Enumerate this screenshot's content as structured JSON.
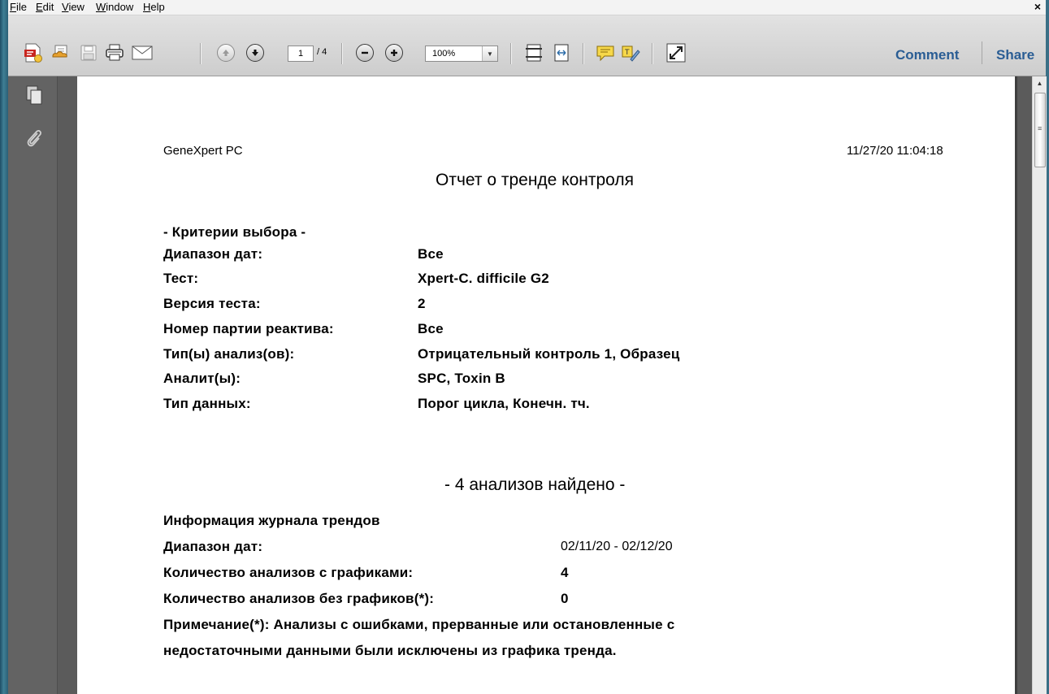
{
  "menu": [
    "File",
    "Edit",
    "View",
    "Window",
    "Help"
  ],
  "window": {
    "close_glyph": "×"
  },
  "toolbar": {
    "icons": [
      "create-pdf-icon",
      "save-to-cloud-icon",
      "save-icon",
      "print-icon",
      "email-icon",
      "previous-page-icon",
      "next-page-icon",
      "zoom-out-icon",
      "zoom-in-icon",
      "fit-page-icon",
      "fit-width-icon",
      "sticky-note-icon",
      "highlight-icon",
      "fullscreen-icon"
    ],
    "page_current": "1",
    "page_total": "/ 4",
    "zoom": "100%",
    "comment": "Comment",
    "share": "Share"
  },
  "colors": {
    "link_blue": "#2a5d94",
    "panel_grey": "#636363",
    "doc_bg": "#5b5b5b"
  },
  "document": {
    "header_left": "GeneXpert PC",
    "header_right": "11/27/20 11:04:18",
    "title": "Отчет о тренде контроля",
    "criteria_heading": "- Критерии выбора -",
    "criteria": [
      {
        "label": "Диапазон дат:",
        "value": "Все"
      },
      {
        "label": "Тест:",
        "value": "Xpert-C. difficile G2"
      },
      {
        "label": "Версия теста:",
        "value": "2"
      },
      {
        "label": "Номер партии реактива:",
        "value": "Все"
      },
      {
        "label": "Тип(ы) анализ(ов):",
        "value": "Отрицательный контроль 1, Образец"
      },
      {
        "label": "Аналит(ы):",
        "value": "SPC, Toxin B"
      },
      {
        "label": "Тип данных:",
        "value": "Порог цикла, Конечн. тч."
      }
    ],
    "found": "- 4 анализов найдено -",
    "log_heading": "Информация журнала трендов",
    "log": [
      {
        "label": "Диапазон дат:",
        "value": "02/11/20 - 02/12/20"
      },
      {
        "label": "Количество анализов с графиками:",
        "value": "4"
      },
      {
        "label": "Количество анализов без графиков(*):",
        "value": "0"
      }
    ],
    "note_line1": "Примечание(*): Анализы с ошибками, прерванные или остановленные с",
    "note_line2": "недостаточными данными были исключены из графика тренда."
  }
}
